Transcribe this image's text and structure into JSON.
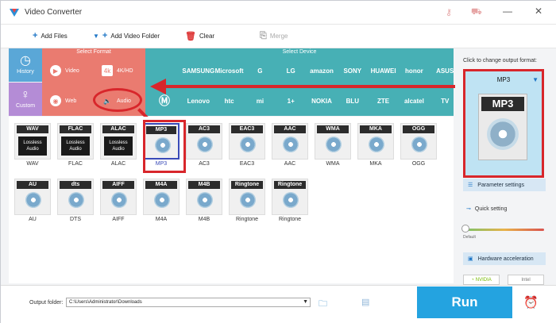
{
  "app": {
    "title": "Video Converter"
  },
  "toolbar": {
    "add_files": "Add Files",
    "add_video_folder": "Add Video Folder",
    "clear": "Clear",
    "merge": "Merge"
  },
  "nav": {
    "history": "History",
    "custom": "Custom"
  },
  "format_panel": {
    "header": "Select Format",
    "items": [
      {
        "label": "Video"
      },
      {
        "label": "4K/HD"
      },
      {
        "label": "Web"
      },
      {
        "label": "Audio"
      }
    ]
  },
  "device_panel": {
    "header": "Select Device",
    "row1": [
      "",
      "SAMSUNG",
      "Microsoft",
      "G",
      "LG",
      "amazon",
      "SONY",
      "HUAWEI",
      "honor",
      "ASUS"
    ],
    "row2": [
      "",
      "Lenovo",
      "htc",
      "mi",
      "1+",
      "NOKIA",
      "BLU",
      "ZTE",
      "alcatel",
      "TV"
    ]
  },
  "formats": [
    {
      "badge": "WAV",
      "sub": "Lossless Audio",
      "label": "WAV"
    },
    {
      "badge": "FLAC",
      "sub": "Lossless Audio",
      "label": "FLAC"
    },
    {
      "badge": "ALAC",
      "sub": "Lossless Audio",
      "label": "ALAC"
    },
    {
      "badge": "MP3",
      "sub": "",
      "label": "MP3",
      "selected": true
    },
    {
      "badge": "AC3",
      "sub": "",
      "label": "AC3"
    },
    {
      "badge": "EAC3",
      "sub": "",
      "label": "EAC3"
    },
    {
      "badge": "AAC",
      "sub": "",
      "label": "AAC"
    },
    {
      "badge": "WMA",
      "sub": "",
      "label": "WMA"
    },
    {
      "badge": "MKA",
      "sub": "",
      "label": "MKA"
    },
    {
      "badge": "OGG",
      "sub": "",
      "label": "OGG"
    },
    {
      "badge": "AU",
      "sub": "",
      "label": "AU"
    },
    {
      "badge": "dts",
      "sub": "",
      "label": "DTS"
    },
    {
      "badge": "AIFF",
      "sub": "",
      "label": "AIFF"
    },
    {
      "badge": "M4A",
      "sub": "",
      "label": "M4A"
    },
    {
      "badge": "M4B",
      "sub": "",
      "label": "M4B"
    },
    {
      "badge": "Ringtone",
      "sub": "",
      "label": "Ringtone"
    },
    {
      "badge": "Ringtone",
      "sub": "",
      "label": "Ringtone"
    }
  ],
  "right_panel": {
    "click_label": "Click to change output format:",
    "output_format": "MP3",
    "output_badge": "MP3",
    "parameter_settings": "Parameter settings",
    "quick_setting": "Quick setting",
    "default_label": "Default",
    "hardware_acceleration": "Hardware acceleration",
    "nvidia": "NVIDIA",
    "intel": "Intel"
  },
  "bottom": {
    "output_folder_label": "Output folder:",
    "output_folder_value": "C:\\Users\\Administrator\\Downloads",
    "run": "Run"
  },
  "colors": {
    "accent_red": "#d8262b",
    "format_panel": "#ea7b70",
    "device_panel": "#47b0b5",
    "run_button": "#24a3e0"
  }
}
